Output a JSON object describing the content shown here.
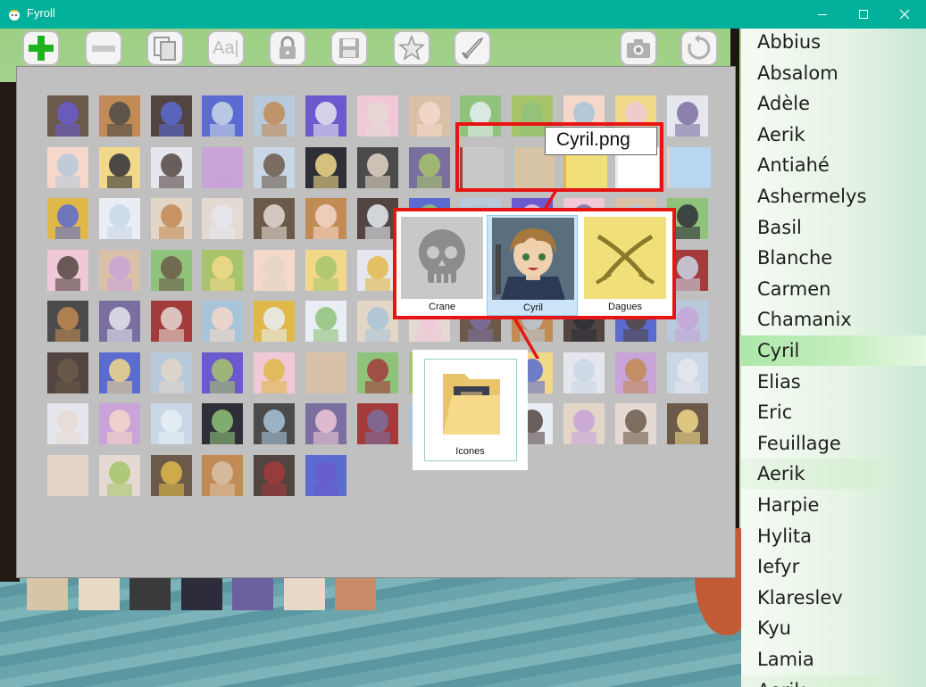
{
  "window": {
    "title": "Fyroll",
    "minimize_icon": "minimize-icon",
    "maximize_icon": "maximize-icon",
    "close_icon": "close-icon"
  },
  "toolbar": {
    "buttons": [
      {
        "id": "add",
        "icon": "plus-icon"
      },
      {
        "id": "remove",
        "icon": "minus-icon"
      },
      {
        "id": "duplicate",
        "icon": "copy-icon"
      },
      {
        "id": "rename",
        "icon": "text-icon",
        "label": "Aa|"
      },
      {
        "id": "lock",
        "icon": "lock-icon"
      },
      {
        "id": "save",
        "icon": "floppy-icon"
      },
      {
        "id": "favorite",
        "icon": "star-icon"
      },
      {
        "id": "battle",
        "icon": "sword-icon"
      },
      {
        "id": "screenshot",
        "icon": "camera-icon"
      },
      {
        "id": "reset",
        "icon": "refresh-icon"
      }
    ]
  },
  "characters": [
    {
      "name": "Abbius"
    },
    {
      "name": "Absalom"
    },
    {
      "name": "Adèle"
    },
    {
      "name": "Aerik"
    },
    {
      "name": "Antiahé"
    },
    {
      "name": "Ashermelys"
    },
    {
      "name": "Basil"
    },
    {
      "name": "Blanche"
    },
    {
      "name": "Carmen"
    },
    {
      "name": "Chamanix"
    },
    {
      "name": "Cyril",
      "selected": true
    },
    {
      "name": "Elias"
    },
    {
      "name": "Eric"
    },
    {
      "name": "Feuillage"
    },
    {
      "name": "Aerik",
      "faded": true
    },
    {
      "name": "Harpie"
    },
    {
      "name": "Hylita"
    },
    {
      "name": "Iefyr"
    },
    {
      "name": "Klareslev"
    },
    {
      "name": "Kyu"
    },
    {
      "name": "Lamia"
    },
    {
      "name": "Aerik",
      "faded": true
    }
  ],
  "tooltip": {
    "text": "Cyril.png"
  },
  "zoom": {
    "tiles": [
      {
        "label": "Crane",
        "icon": "skull-icon",
        "color": "#c8c8c8"
      },
      {
        "label": "Cyril",
        "icon": "portrait-icon",
        "color": "#8a6a3c",
        "selected": true
      },
      {
        "label": "Dagues",
        "icon": "daggers-icon",
        "color": "#f1e07a"
      }
    ]
  },
  "folder": {
    "label": "Icones",
    "icon": "folder-icon"
  },
  "colors": {
    "titlebar": "#00b09a",
    "highlight_red": "#e81313",
    "panel_bg": "#c0c0c0",
    "selected_row": "#aee7a9"
  }
}
